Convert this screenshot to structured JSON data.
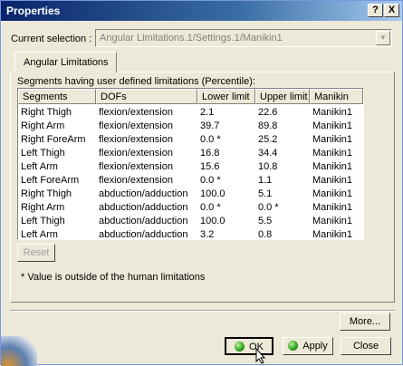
{
  "window": {
    "title": "Properties",
    "help_btn": "?",
    "close_btn": "X"
  },
  "selection": {
    "label": "Current selection :",
    "value": "Angular Limitations.1/Settings.1/Manikin1"
  },
  "tabs": [
    {
      "label": "Angular Limitations"
    }
  ],
  "table": {
    "caption": "Segments having user defined limitations (Percentile):",
    "columns": [
      "Segments",
      "DOFs",
      "Lower limit",
      "Upper limit",
      "Manikin"
    ],
    "rows": [
      [
        "Right Thigh",
        "flexion/extension",
        "2.1",
        "22.6",
        "Manikin1"
      ],
      [
        "Right Arm",
        "flexion/extension",
        "39.7",
        "89.8",
        "Manikin1"
      ],
      [
        "Right ForeArm",
        "flexion/extension",
        "0.0 *",
        "25.2",
        "Manikin1"
      ],
      [
        "Left Thigh",
        "flexion/extension",
        "16.8",
        "34.4",
        "Manikin1"
      ],
      [
        "Left Arm",
        "flexion/extension",
        "15.6",
        "10.8",
        "Manikin1"
      ],
      [
        "Left ForeArm",
        "flexion/extension",
        "0.0 *",
        "1.1",
        "Manikin1"
      ],
      [
        "Right Thigh",
        "abduction/adduction",
        "100.0",
        "5.1",
        "Manikin1"
      ],
      [
        "Right Arm",
        "abduction/adduction",
        "0.0 *",
        "0.0 *",
        "Manikin1"
      ],
      [
        "Left Thigh",
        "abduction/adduction",
        "100.0",
        "5.5",
        "Manikin1"
      ],
      [
        "Left Arm",
        "abduction/adduction",
        "3.2",
        "0.8",
        "Manikin1"
      ]
    ]
  },
  "reset_label": "Reset",
  "note": "* Value is outside of the human limitations",
  "buttons": {
    "more": "More...",
    "ok": "OK",
    "apply": "Apply",
    "close": "Close"
  },
  "icons": {
    "ok": "green-ball-icon",
    "apply": "green-ball-icon"
  },
  "colors": {
    "title_start": "#0a246a",
    "title_end": "#a6caf0",
    "dialog_bg": "#ece9d8"
  }
}
